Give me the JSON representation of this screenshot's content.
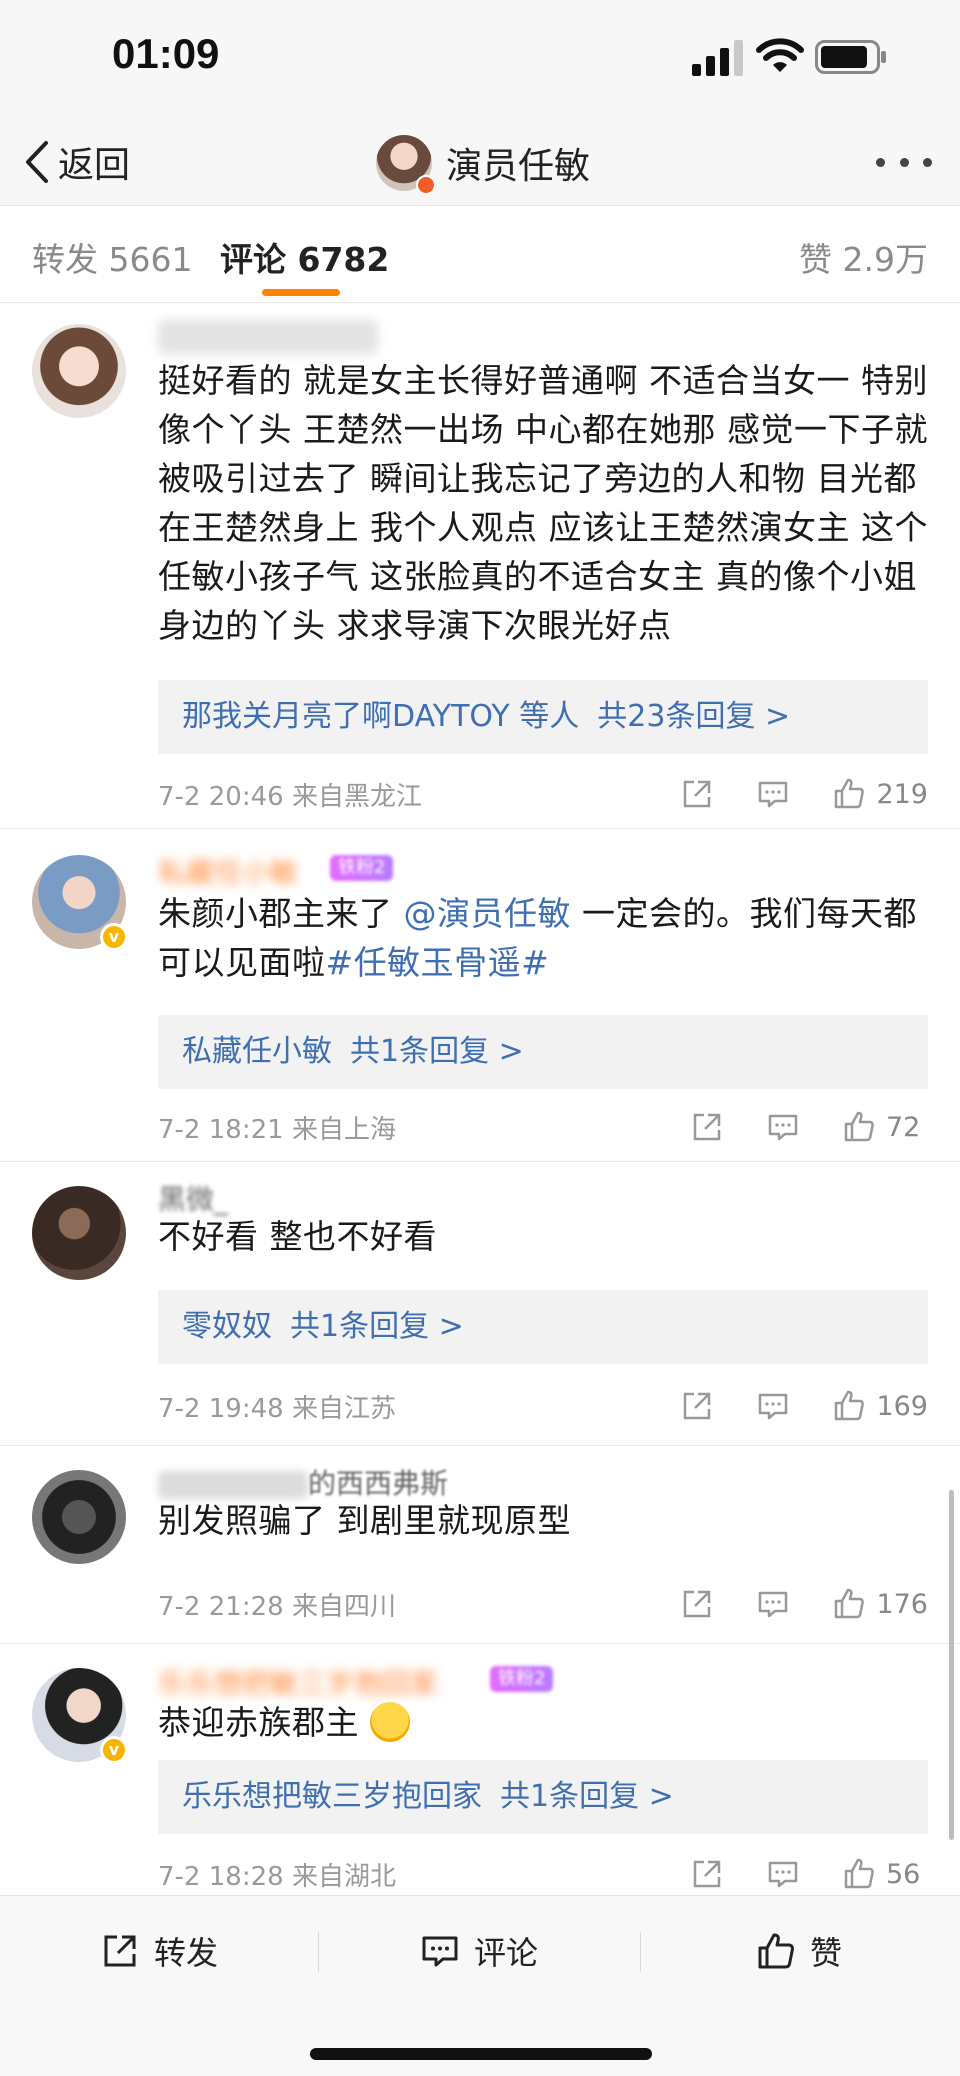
{
  "status_bar": {
    "time": "01:09"
  },
  "nav": {
    "back_label": "返回",
    "title": "演员任敏"
  },
  "tabs": {
    "repost": "转发 5661",
    "comment": "评论 6782",
    "like": "赞 2.9万"
  },
  "comments": [
    {
      "text": "挺好看的 就是女主长得好普通啊 不适合当女一 特别像个丫头 王楚然一出场 中心都在她那 感觉一下子就被吸引过去了 瞬间让我忘记了旁边的人和物 目光都在王楚然身上 我个人观点 应该让王楚然演女主 这个任敏小孩子气 这张脸真的不适合女主 真的像个小姐身边的丫头 求求导演下次眼光好点",
      "reply_text": "那我关月亮了啊DAYTOY 等人",
      "reply_count": "共23条回复 >",
      "time": "7-2 20:46",
      "location": "来自黑龙江",
      "likes": "219"
    },
    {
      "username_partial": "私藏任小敏",
      "text_before": "朱颜小郡主来了",
      "mention": "@演员任敏",
      "text_after": " 一定会的。我们每天都可以见面啦",
      "hashtag": "#任敏玉骨遥#",
      "reply_text": "私藏任小敏",
      "reply_count": "共1条回复 >",
      "time": "7-2 18:21",
      "location": "来自上海",
      "likes": "72"
    },
    {
      "username_partial": "黑微_",
      "text": "不好看 整也不好看",
      "reply_text": "零奴奴",
      "reply_count": "共1条回复 >",
      "time": "7-2 19:48",
      "location": "来自江苏",
      "likes": "169"
    },
    {
      "username_partial": "的西西弗斯",
      "text": "别发照骗了  到剧里就现原型",
      "time": "7-2 21:28",
      "location": "来自四川",
      "likes": "176"
    },
    {
      "username_partial": "乐乐想把敏三岁抱回家",
      "text": "恭迎赤族郡主",
      "reply_text": "乐乐想把敏三岁抱回家",
      "reply_count": "共1条回复 >",
      "time": "7-2 18:28",
      "location": "来自湖北",
      "likes": "56"
    }
  ],
  "bottom_bar": {
    "repost": "转发",
    "comment": "评论",
    "like": "赞"
  },
  "colors": {
    "accent": "#ff8200",
    "link": "#3f6fb0",
    "verified": "#f7b500"
  },
  "icons": [
    "chevron-left-icon",
    "signal-icon",
    "wifi-icon",
    "battery-icon",
    "more-icon",
    "share-icon",
    "comment-icon",
    "thumbs-up-icon"
  ]
}
